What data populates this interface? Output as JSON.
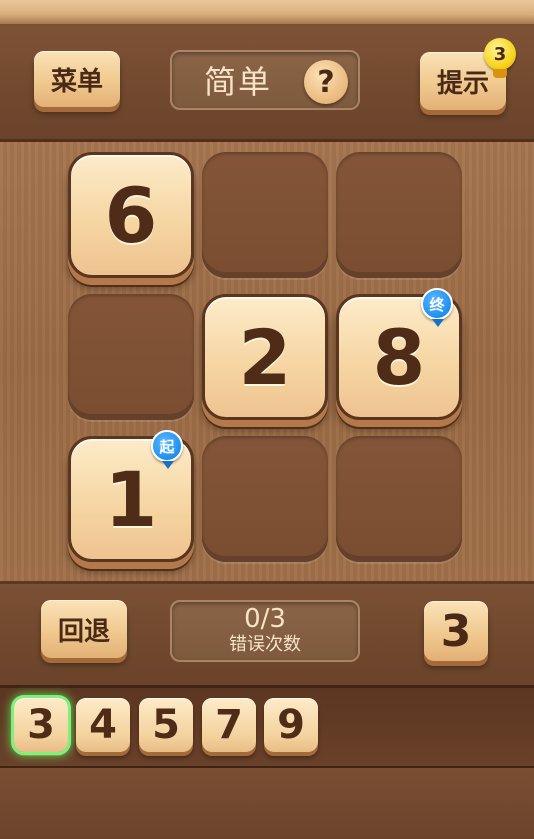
{
  "header": {
    "menu_label": "菜单",
    "difficulty": "简单",
    "help_symbol": "?",
    "hint_label": "提示",
    "hint_count": "3"
  },
  "board": {
    "cells": [
      {
        "value": "6",
        "marker": ""
      },
      {
        "value": "",
        "marker": ""
      },
      {
        "value": "",
        "marker": ""
      },
      {
        "value": "",
        "marker": ""
      },
      {
        "value": "2",
        "marker": ""
      },
      {
        "value": "8",
        "marker": "终"
      },
      {
        "value": "1",
        "marker": "起"
      },
      {
        "value": "",
        "marker": ""
      },
      {
        "value": "",
        "marker": ""
      }
    ]
  },
  "controls": {
    "undo_label": "回退",
    "errors_value": "0/3",
    "errors_label": "错误次数",
    "current_number": "3"
  },
  "tray": {
    "tiles": [
      "3",
      "4",
      "5",
      "7",
      "9"
    ],
    "selected": "3"
  },
  "colors": {
    "wood_dark": "#6b4329",
    "tile_face": "#f5d4a0",
    "marker_blue": "#1f8fef",
    "selection_green": "#5ee05a"
  }
}
